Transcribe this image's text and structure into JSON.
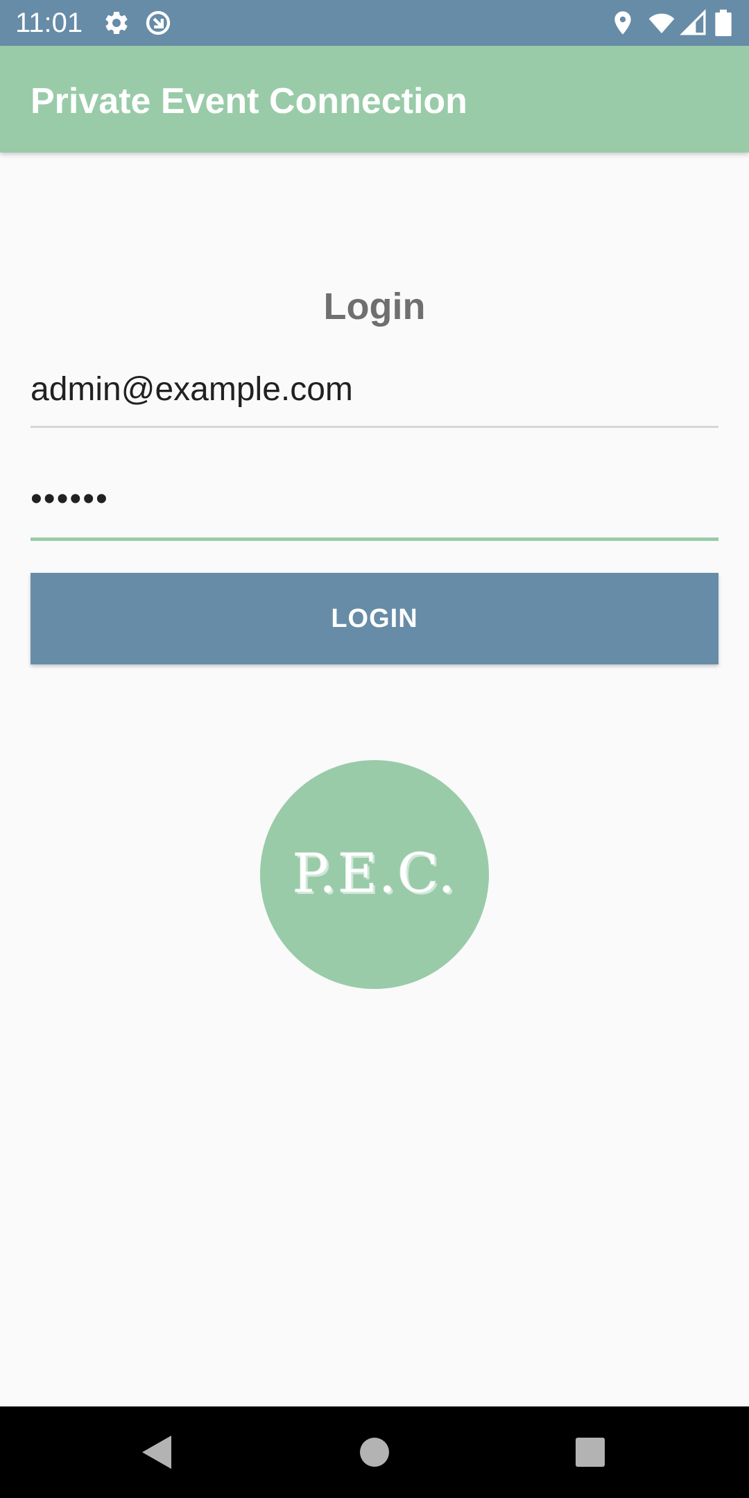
{
  "status_bar": {
    "time": "11:01",
    "left_icons": [
      "settings-icon",
      "sync-icon"
    ],
    "right_icons": [
      "location-icon",
      "wifi-icon",
      "cell-signal-icon",
      "battery-icon"
    ]
  },
  "app_bar": {
    "title": "Private Event Connection"
  },
  "login_form": {
    "heading": "Login",
    "email_value": "admin@example.com",
    "password_value": "••••••",
    "button_label": "LOGIN"
  },
  "logo": {
    "text": "P.E.C."
  },
  "nav_bar": {
    "buttons": [
      "back-icon",
      "home-icon",
      "recents-icon"
    ]
  },
  "colors": {
    "primary": "#99cba9",
    "accent": "#678ca7",
    "background": "#fafafa"
  }
}
